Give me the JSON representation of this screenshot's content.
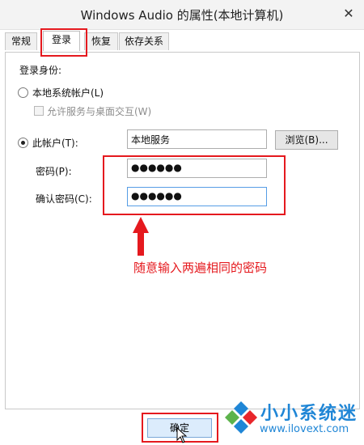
{
  "window": {
    "title": "Windows Audio 的属性(本地计算机)",
    "close": "✕"
  },
  "tabs": [
    {
      "label": "常规",
      "active": false
    },
    {
      "label": "登录",
      "active": true
    },
    {
      "label": "恢复",
      "active": false
    },
    {
      "label": "依存关系",
      "active": false
    }
  ],
  "logon": {
    "section_label": "登录身份:",
    "local_system_label": "本地系统帐户(L)",
    "interact_desktop_label": "允许服务与桌面交互(W)",
    "this_account_label": "此帐户(T):",
    "this_account_value": "本地服务",
    "browse_label": "浏览(B)...",
    "password_label": "密码(P):",
    "password_value": "●●●●●●",
    "confirm_label": "确认密码(C):",
    "confirm_value": "●●●●●●",
    "selected": "this_account",
    "interact_desktop_checked": false
  },
  "annotation": {
    "hint": "随意输入两遍相同的密码",
    "color": "#e5191e"
  },
  "footer": {
    "ok_label": "确定"
  },
  "watermark": {
    "brand": "小小系统迷",
    "url": "www.ilovext.com",
    "color": "#1f86d6"
  }
}
